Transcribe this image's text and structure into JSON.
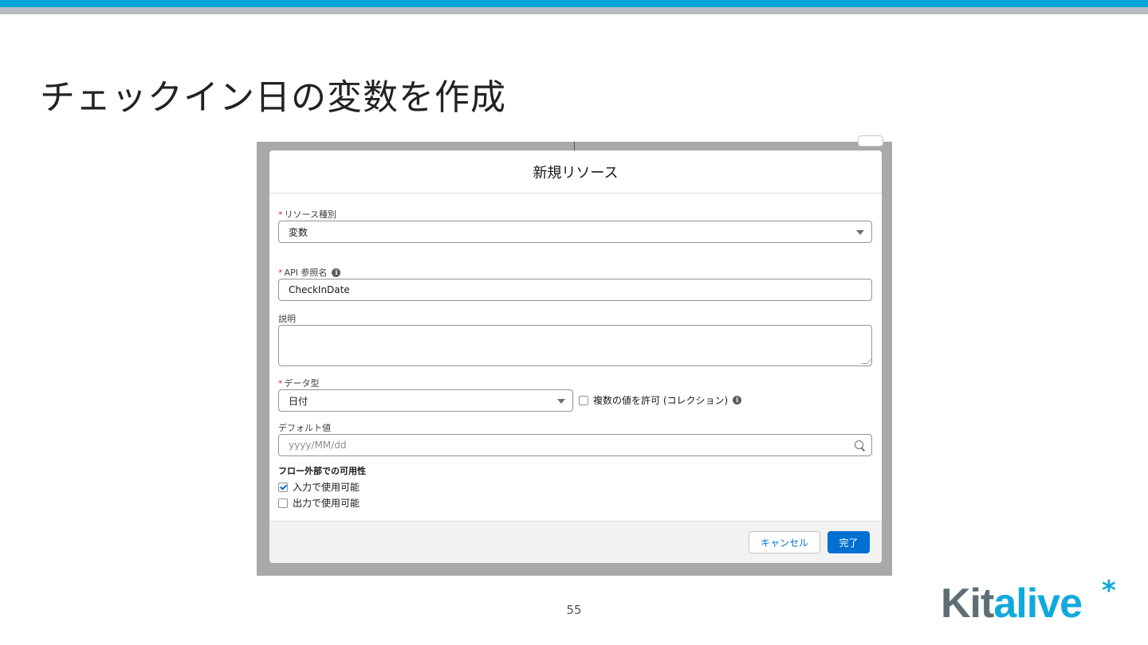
{
  "slide": {
    "title": "チェックイン日の変数を作成",
    "page_number": "55",
    "logo": {
      "prefix": "Kit",
      "suffix": "alive",
      "star": "*"
    },
    "colors": {
      "top_bar": "#0aa5d8",
      "top_bar_secondary": "#b4bcc3",
      "logo_blue": "#10a9dd",
      "logo_grey": "#5f6e75"
    }
  },
  "modal": {
    "title": "新規リソース",
    "resource_type": {
      "label": "リソース種別",
      "required_mark": "*",
      "value": "変数",
      "icon": "chevron-down-icon"
    },
    "api_name": {
      "label": "API 参照名",
      "required_mark": "*",
      "value": "CheckInDate",
      "info_icon": "i"
    },
    "description": {
      "label": "説明",
      "value": ""
    },
    "data_type": {
      "label": "データ型",
      "required_mark": "*",
      "value": "日付",
      "icon": "chevron-down-icon"
    },
    "allow_multiple": {
      "label": "複数の値を許可 (コレクション)",
      "checked": false,
      "info_icon": "i"
    },
    "default_value": {
      "label": "デフォルト値",
      "placeholder": "yyyy/MM/dd",
      "icon": "search-icon"
    },
    "availability": {
      "heading": "フロー外部での可用性",
      "options": [
        {
          "label": "入力で使用可能",
          "checked": true
        },
        {
          "label": "出力で使用可能",
          "checked": false
        }
      ]
    },
    "footer": {
      "cancel_label": "キャンセル",
      "done_label": "完了"
    },
    "colors": {
      "brand": "#0070d2",
      "required": "#c23934"
    }
  }
}
